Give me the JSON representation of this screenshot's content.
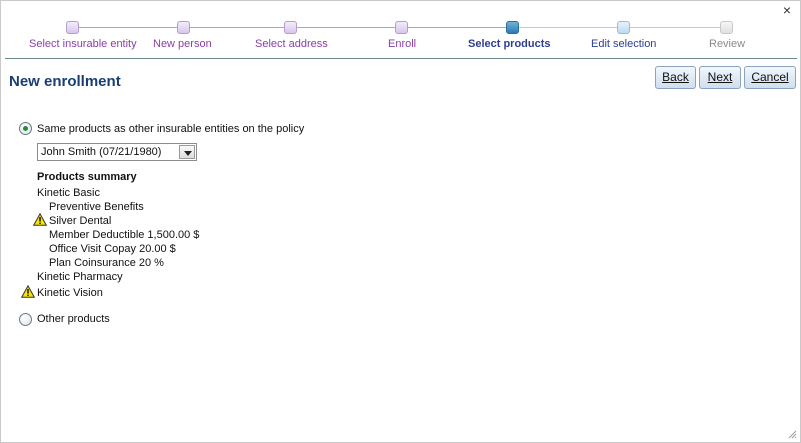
{
  "close_glyph": "×",
  "steps": [
    {
      "label": "Select insurable entity",
      "state": "done"
    },
    {
      "label": "New person",
      "state": "done"
    },
    {
      "label": "Select address",
      "state": "done"
    },
    {
      "label": "Enroll",
      "state": "done"
    },
    {
      "label": "Select products",
      "state": "current"
    },
    {
      "label": "Edit selection",
      "state": "next"
    },
    {
      "label": "Review",
      "state": "future"
    }
  ],
  "page_title": "New enrollment",
  "buttons": {
    "back": "Back",
    "next": "Next",
    "cancel": "Cancel"
  },
  "option_same": {
    "label": "Same products as other insurable entities on the policy",
    "selected": true
  },
  "entity_select": {
    "value": "John Smith (07/21/1980)"
  },
  "products_summary": {
    "heading": "Products summary",
    "lines": [
      {
        "text": "Kinetic Basic",
        "warning": false
      },
      {
        "text": "Preventive Benefits",
        "warning": false
      },
      {
        "text": "Silver Dental",
        "warning": true
      },
      {
        "text": "Member Deductible 1,500.00  $",
        "warning": false
      },
      {
        "text": "Office Visit Copay 20.00  $",
        "warning": false
      },
      {
        "text": "Plan Coinsurance 20  %",
        "warning": false
      },
      {
        "text": "Kinetic Pharmacy",
        "warning": false
      },
      {
        "text": "Kinetic Vision",
        "warning": true
      }
    ]
  },
  "option_other": {
    "label": "Other products",
    "selected": false
  },
  "colors": {
    "accent": "#1a3e72",
    "step_done": "#8b3fa5",
    "step_current": "#2a7bb0"
  }
}
